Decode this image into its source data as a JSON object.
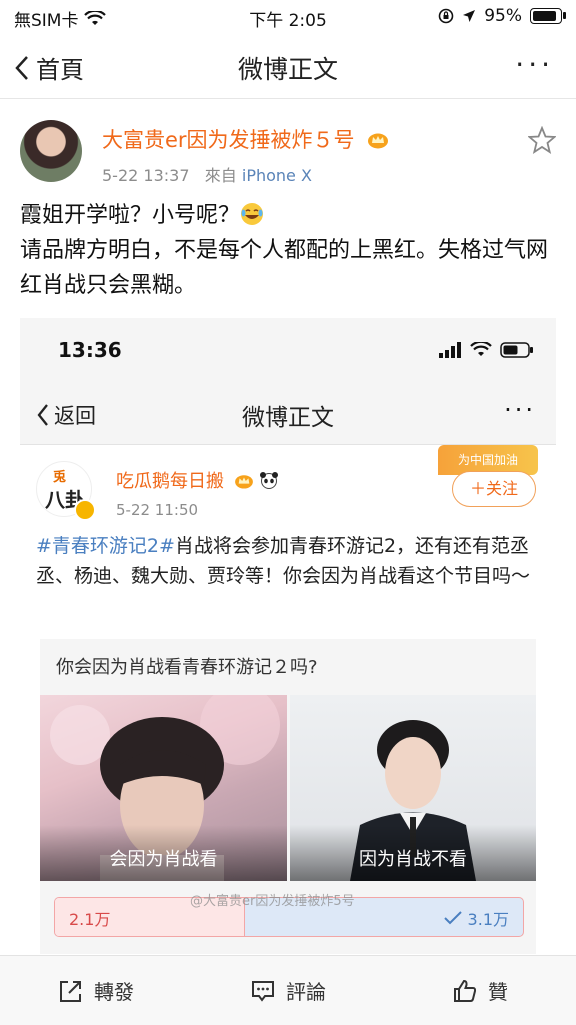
{
  "status_bar": {
    "carrier": "無SIM卡",
    "time": "下午 2:05",
    "battery": "95%",
    "battery_level": 0.95
  },
  "nav": {
    "back_label": "首頁",
    "title": "微博正文",
    "more_label": "···"
  },
  "post": {
    "username": "大富贵er因为发捶被炸５号",
    "time": "5-22 13:37",
    "source_prefix": "來自",
    "source": "iPhone X",
    "text_line1": "霞姐开学啦？小号呢？",
    "text_line2": "请品牌方明白，不是每个人都配的上黑红。失格过气网红肖战只会黑糊。"
  },
  "screenshot": {
    "status_time": "13:36",
    "nav_back": "返回",
    "nav_title": "微博正文",
    "nav_more": "···",
    "avatar_text_top": "兎",
    "avatar_text_bottom": "八卦",
    "username": "吃瓜鹅每日搬",
    "time": "5-22 11:50",
    "promo": "为中国加油",
    "follow_label": "＋关注",
    "hashtag": "#青春环游记2#",
    "body": "肖战将会参加青春环游记2，还有还有范丞丞、杨迪、魏大勋、贾玲等！你会因为肖战看这个节目吗～",
    "poll": {
      "question": "你会因为肖战看青春环游记２吗?",
      "option_left": "会因为肖战看",
      "option_right": "因为肖战不看",
      "left_value": "2.1万",
      "right_value": "3.1万",
      "left_share": 0.404
    }
  },
  "watermark": "@大富贵er因为发捶被炸5号",
  "bottom": {
    "repost": "轉發",
    "comment": "評論",
    "like": "贊"
  },
  "colors": {
    "accent_orange": "#f0691a",
    "link_blue": "#4a7fc0",
    "poll_red": "#d84a4a"
  }
}
